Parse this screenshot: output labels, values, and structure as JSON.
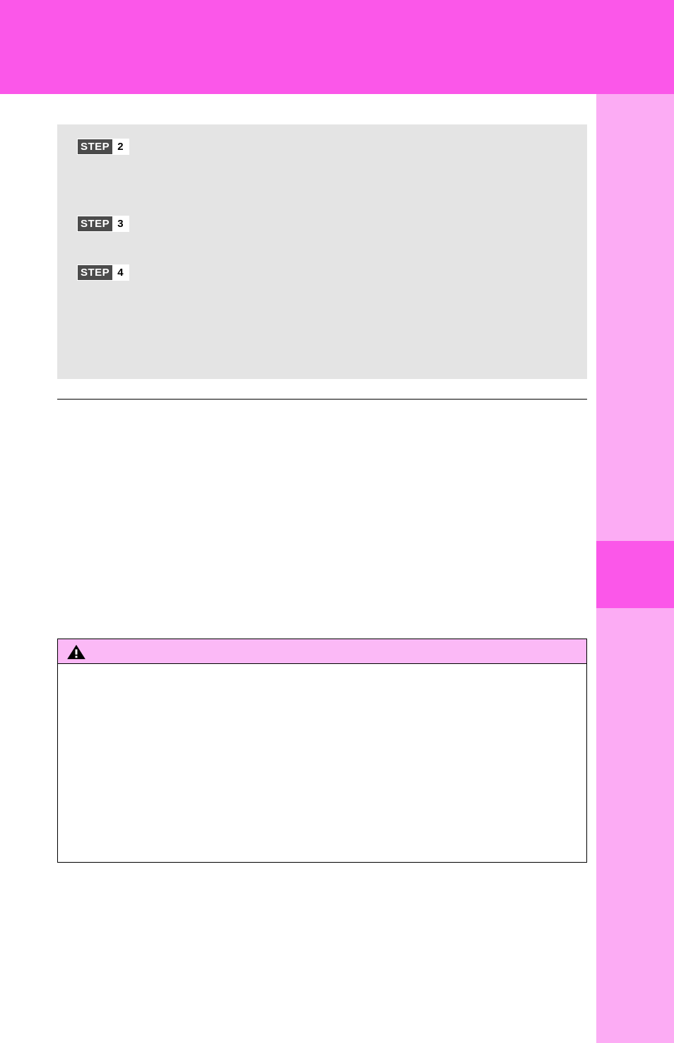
{
  "steps": {
    "label": "STEP",
    "items": [
      {
        "number": "2"
      },
      {
        "number": "3"
      },
      {
        "number": "4"
      }
    ]
  }
}
